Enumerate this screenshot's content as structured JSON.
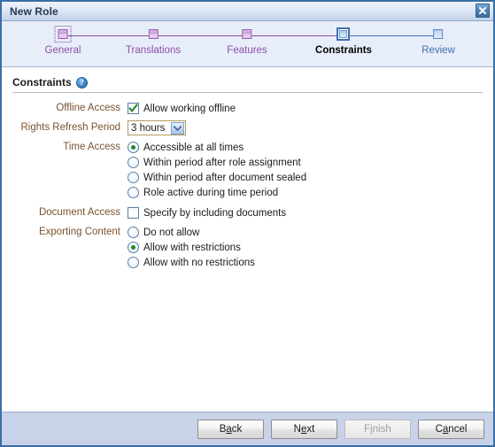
{
  "window": {
    "title": "New Role",
    "close_icon": "close-icon"
  },
  "wizard": {
    "steps": [
      {
        "label": "General",
        "state": "done",
        "focused": true
      },
      {
        "label": "Translations",
        "state": "done",
        "focused": false
      },
      {
        "label": "Features",
        "state": "done",
        "focused": false
      },
      {
        "label": "Constraints",
        "state": "current",
        "focused": false
      },
      {
        "label": "Review",
        "state": "todo",
        "focused": false
      }
    ]
  },
  "section": {
    "title": "Constraints",
    "help_icon_glyph": "?",
    "help_icon_name": "help-icon"
  },
  "fields": {
    "offline_access": {
      "label": "Offline Access",
      "checkbox": {
        "text": "Allow working offline",
        "checked": true
      }
    },
    "rights_refresh_period": {
      "label": "Rights Refresh Period",
      "select": {
        "value": "3 hours",
        "options": [
          "3 hours"
        ]
      }
    },
    "time_access": {
      "label": "Time Access",
      "radios": [
        {
          "text": "Accessible at all times",
          "selected": true
        },
        {
          "text": "Within period after role assignment",
          "selected": false
        },
        {
          "text": "Within period after document sealed",
          "selected": false
        },
        {
          "text": "Role active during time period",
          "selected": false
        }
      ]
    },
    "document_access": {
      "label": "Document Access",
      "checkbox": {
        "text": "Specify by including documents",
        "checked": false
      }
    },
    "exporting_content": {
      "label": "Exporting Content",
      "radios": [
        {
          "text": "Do not allow",
          "selected": false
        },
        {
          "text": "Allow with restrictions",
          "selected": true
        },
        {
          "text": "Allow with no restrictions",
          "selected": false
        }
      ]
    }
  },
  "buttons": [
    {
      "name": "back-button",
      "pre": "B",
      "mn": "a",
      "post": "ck",
      "disabled": false
    },
    {
      "name": "next-button",
      "pre": "N",
      "mn": "e",
      "post": "xt",
      "disabled": false
    },
    {
      "name": "finish-button",
      "pre": "F",
      "mn": "i",
      "post": "nish",
      "disabled": true
    },
    {
      "name": "cancel-button",
      "pre": "C",
      "mn": "a",
      "post": "ncel",
      "disabled": false
    }
  ],
  "colors": {
    "accent_blue": "#3a6ea5",
    "step_done_purple": "#8d4fa3",
    "step_todo_blue": "#3f6eae",
    "label_brown": "#7a5230",
    "check_green": "#1f8a2e",
    "buttonbar_bg": "#c8d2e8",
    "train_bg": "#e8edfa"
  }
}
